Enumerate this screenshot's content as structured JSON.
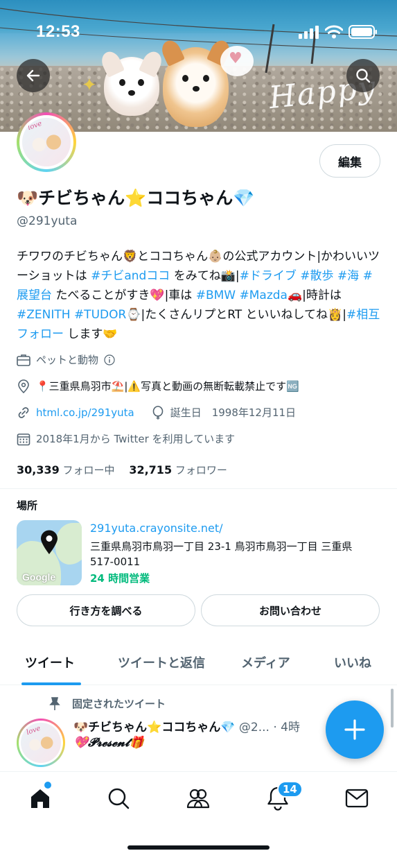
{
  "status_bar": {
    "time": "12:53"
  },
  "profile": {
    "name": "🐶チビちゃん⭐️ココちゃん💎",
    "handle": "@291yuta",
    "edit_label": "編集",
    "bio_parts": [
      {
        "text": "チワワのチビちゃん🦁とココちゃん👶🏼の公式アカウント|かわいいツーショットは ",
        "tag": false
      },
      {
        "text": "#チビandココ",
        "tag": true
      },
      {
        "text": " をみてね📸|",
        "tag": false
      },
      {
        "text": "#ドライブ",
        "tag": true
      },
      {
        "text": " ",
        "tag": false
      },
      {
        "text": "#散歩",
        "tag": true
      },
      {
        "text": " ",
        "tag": false
      },
      {
        "text": "#海",
        "tag": true
      },
      {
        "text": " ",
        "tag": false
      },
      {
        "text": "#展望台",
        "tag": true
      },
      {
        "text": " たべることがすき💖|車は ",
        "tag": false
      },
      {
        "text": "#BMW",
        "tag": true
      },
      {
        "text": " ",
        "tag": false
      },
      {
        "text": "#Mazda",
        "tag": true
      },
      {
        "text": "🚗|時計は ",
        "tag": false
      },
      {
        "text": "#ZENITH",
        "tag": true
      },
      {
        "text": " ",
        "tag": false
      },
      {
        "text": "#TUDOR",
        "tag": true
      },
      {
        "text": "⌚️|たくさんリプとRT といいねしてね👸|",
        "tag": false
      },
      {
        "text": "#相互フォロー",
        "tag": true
      },
      {
        "text": " します🤝",
        "tag": false
      }
    ],
    "category": "ペットと動物",
    "location": "📍三重県鳥羽市⛱️|⚠️写真と動画の無断転載禁止です🆖",
    "website": "html.co.jp/291yuta",
    "birthday": "誕生日　1998年12月11日",
    "joined": "2018年1月から Twitter を利用しています",
    "following_count": "30,339",
    "following_label": "フォロー中",
    "followers_count": "32,715",
    "followers_label": "フォロワー"
  },
  "business": {
    "section_label": "場所",
    "map_brand": "Google",
    "site": "291yuta.crayonsite.net/",
    "address": "三重県鳥羽市鳥羽一丁目 23-1 鳥羽市鳥羽一丁目 三重県 517-0011",
    "hours": "24 時間営業",
    "directions_label": "行き方を調べる",
    "contact_label": "お問い合わせ"
  },
  "tabs": [
    {
      "label": "ツイート",
      "active": true
    },
    {
      "label": "ツイートと返信",
      "active": false
    },
    {
      "label": "メディア",
      "active": false
    },
    {
      "label": "いいね",
      "active": false
    }
  ],
  "pinned_tweet": {
    "pinned_label": "固定されたツイート",
    "author": "🐶チビちゃん⭐️ココちゃん💎",
    "handle_time": " @2... · 4時",
    "text": "💖𝓟𝓻𝓮𝓼𝓮𝓷𝓽🎁"
  },
  "bottom_nav": {
    "notifications_badge": "14"
  },
  "colors": {
    "accent": "#1d9bf0",
    "hours_green": "#00ba7c",
    "text": "#0f1419",
    "muted": "#536471"
  }
}
